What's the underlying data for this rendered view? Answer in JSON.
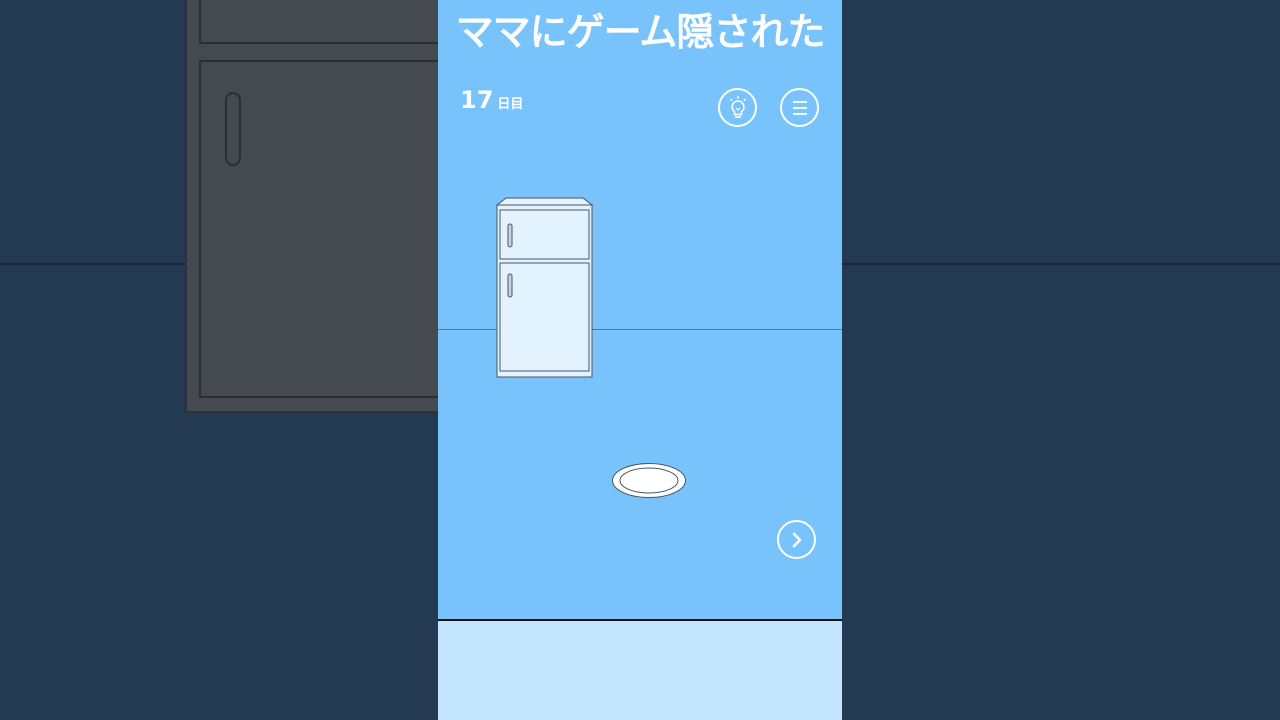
{
  "header": {
    "title": "ママにゲーム隠された"
  },
  "status": {
    "day_number": "17",
    "day_suffix": "日目"
  },
  "icons": {
    "hint": "lightbulb-icon",
    "menu": "menu-icon",
    "next": "chevron-right-icon"
  },
  "colors": {
    "sky": "#78c3fc",
    "floor_panel": "#c3e4fd",
    "page_background": "#243a52",
    "fridge": "#e2f2fe"
  }
}
